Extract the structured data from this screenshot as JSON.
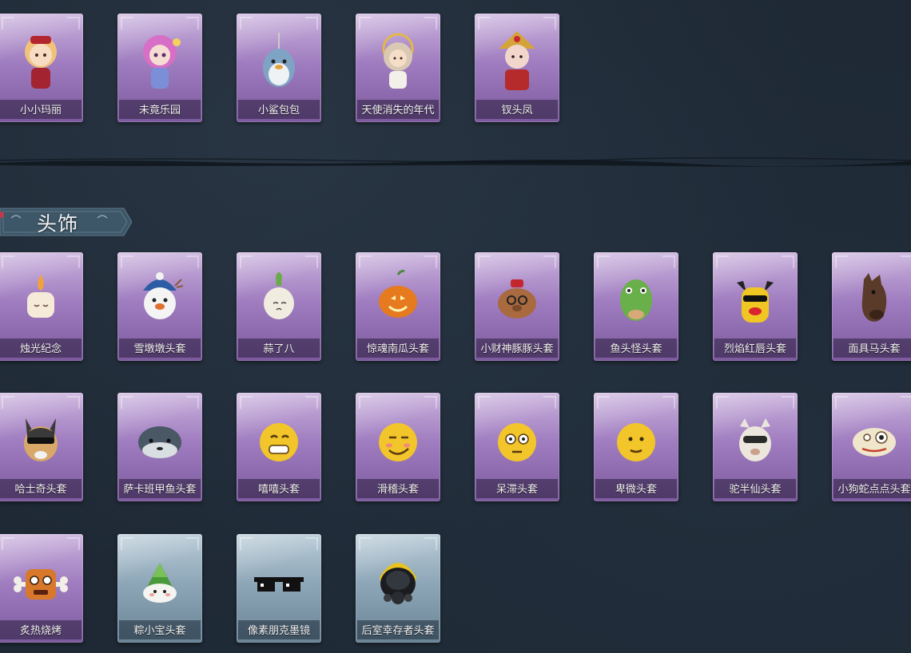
{
  "top_items": [
    {
      "label": "小小玛丽",
      "icon": "doll-girl-icon",
      "frame": "purple"
    },
    {
      "label": "未竟乐园",
      "icon": "pink-girl-icon",
      "frame": "purple"
    },
    {
      "label": "小鲨包包",
      "icon": "shark-bag-icon",
      "frame": "purple"
    },
    {
      "label": "天使消失的年代",
      "icon": "angel-girl-icon",
      "frame": "purple"
    },
    {
      "label": "钗头凤",
      "icon": "opera-queen-icon",
      "frame": "purple"
    }
  ],
  "section": {
    "title": "头饰"
  },
  "headwear_items": [
    {
      "label": "烛光纪念",
      "icon": "candle-icon",
      "frame": "purple"
    },
    {
      "label": "雪墩墩头套",
      "icon": "snowman-icon",
      "frame": "purple"
    },
    {
      "label": "蒜了八",
      "icon": "garlic-icon",
      "frame": "purple"
    },
    {
      "label": "惊魂南瓜头套",
      "icon": "pumpkin-icon",
      "frame": "purple"
    },
    {
      "label": "小财神豚豚头套",
      "icon": "capybara-icon",
      "frame": "purple"
    },
    {
      "label": "鱼头怪头套",
      "icon": "fish-head-icon",
      "frame": "purple"
    },
    {
      "label": "烈焰红唇头套",
      "icon": "yellow-mascot-icon",
      "frame": "purple"
    },
    {
      "label": "面具马头套",
      "icon": "horse-mask-icon",
      "frame": "purple"
    },
    {
      "label": "哈士奇头套",
      "icon": "husky-icon",
      "frame": "purple"
    },
    {
      "label": "萨卡班甲鱼头套",
      "icon": "sacabambaspis-icon",
      "frame": "purple"
    },
    {
      "label": "嘻嘻头套",
      "icon": "grin-emoji-icon",
      "frame": "purple"
    },
    {
      "label": "滑稽头套",
      "icon": "smirk-emoji-icon",
      "frame": "purple"
    },
    {
      "label": "呆滞头套",
      "icon": "dazed-emoji-icon",
      "frame": "purple"
    },
    {
      "label": "卑微头套",
      "icon": "humble-emoji-icon",
      "frame": "purple"
    },
    {
      "label": "驼半仙头套",
      "icon": "alpaca-icon",
      "frame": "purple"
    },
    {
      "label": "小狗蛇点点头套",
      "icon": "snake-icon",
      "frame": "purple"
    },
    {
      "label": "炙热烧烤",
      "icon": "bbq-meat-icon",
      "frame": "purple"
    },
    {
      "label": "粽小宝头套",
      "icon": "zongzi-icon",
      "frame": "blue"
    },
    {
      "label": "像素朋克墨镜",
      "icon": "pixel-sunglasses-icon",
      "frame": "blue"
    },
    {
      "label": "后室幸存者头套",
      "icon": "gas-mask-helmet-icon",
      "frame": "blue"
    }
  ]
}
